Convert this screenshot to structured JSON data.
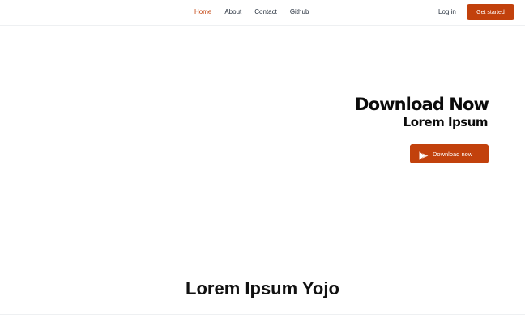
{
  "nav": {
    "links": [
      {
        "label": "Home",
        "active": true
      },
      {
        "label": "About",
        "active": false
      },
      {
        "label": "Contact",
        "active": false
      },
      {
        "label": "Github",
        "active": false
      }
    ],
    "login_label": "Log in",
    "cta_label": "Get started"
  },
  "hero": {
    "title": "Download Now",
    "subtitle": "Lorem Ipsum",
    "download_label": "Download now",
    "download_icon": "play-store-icon"
  },
  "section": {
    "heading": "Lorem Ipsum Yojo"
  },
  "colors": {
    "accent": "#c2410c",
    "text": "#111827",
    "background": "#ffffff"
  }
}
